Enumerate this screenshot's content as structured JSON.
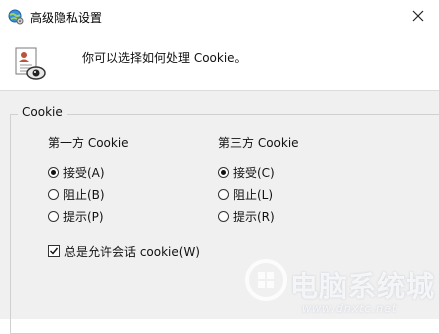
{
  "window": {
    "title": "高级隐私设置",
    "icons": {
      "title": "globe-settings-icon",
      "close": "close-icon"
    }
  },
  "header": {
    "text": "你可以选择如何处理 Cookie。",
    "icon": "privacy-document-eye-icon"
  },
  "cookie_group": {
    "legend": "Cookie",
    "first_party": {
      "heading": "第一方 Cookie",
      "options": [
        {
          "label": "接受(A)",
          "selected": true
        },
        {
          "label": "阻止(B)",
          "selected": false
        },
        {
          "label": "提示(P)",
          "selected": false
        }
      ]
    },
    "third_party": {
      "heading": "第三方 Cookie",
      "options": [
        {
          "label": "接受(C)",
          "selected": true
        },
        {
          "label": "阻止(L)",
          "selected": false
        },
        {
          "label": "提示(R)",
          "selected": false
        }
      ]
    },
    "session_checkbox": {
      "label": "总是允许会话 cookie(W)",
      "checked": true
    }
  },
  "watermark": {
    "text": "电脑系统城",
    "url": "www.dnxtc.net",
    "icon": "watermark-logo-icon"
  }
}
